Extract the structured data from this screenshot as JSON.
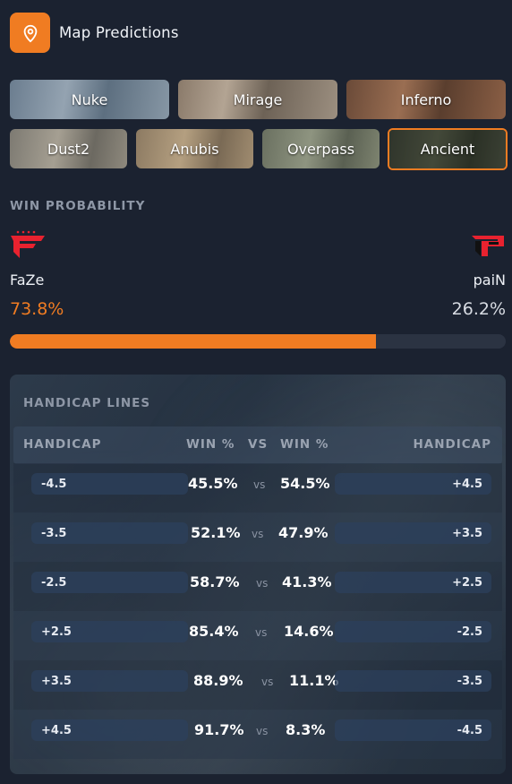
{
  "header": {
    "title": "Map Predictions",
    "icon": "map-pin-icon",
    "accent": "#f07c22"
  },
  "maps": [
    {
      "label": "Nuke",
      "active": false
    },
    {
      "label": "Mirage",
      "active": false
    },
    {
      "label": "Inferno",
      "active": false
    },
    {
      "label": "Dust2",
      "active": false
    },
    {
      "label": "Anubis",
      "active": false
    },
    {
      "label": "Overpass",
      "active": false
    },
    {
      "label": "Ancient",
      "active": true
    }
  ],
  "win_probability": {
    "label": "WIN PROBABILITY",
    "team1": {
      "name": "FaZe",
      "pct": "73.8%",
      "pct_value": 73.8,
      "color": "#f07c22",
      "logo": "faze-logo"
    },
    "team2": {
      "name": "paiN",
      "pct": "26.2%",
      "pct_value": 26.2,
      "color": "#d7dbe2",
      "logo": "pain-logo"
    }
  },
  "handicap": {
    "label": "HANDICAP LINES",
    "headers": {
      "left": "HANDICAP",
      "win_left": "WIN %",
      "vs": "VS",
      "win_right": "WIN %",
      "right": "HANDICAP"
    },
    "rows": [
      {
        "left": "-4.5",
        "win_left": "45.5%",
        "vs": "vs",
        "win_right": "54.5%",
        "right": "+4.5"
      },
      {
        "left": "-3.5",
        "win_left": "52.1%",
        "vs": "vs",
        "win_right": "47.9%",
        "right": "+3.5"
      },
      {
        "left": "-2.5",
        "win_left": "58.7%",
        "vs": "vs",
        "win_right": "41.3%",
        "right": "+2.5"
      },
      {
        "left": "+2.5",
        "win_left": "85.4%",
        "vs": "vs",
        "win_right": "14.6%",
        "right": "-2.5"
      },
      {
        "left": "+3.5",
        "win_left": "88.9%",
        "vs": "vs",
        "win_right": "11.1%",
        "right": "-3.5"
      },
      {
        "left": "+4.5",
        "win_left": "91.7%",
        "vs": "vs",
        "win_right": "8.3%",
        "right": "-4.5"
      }
    ]
  }
}
